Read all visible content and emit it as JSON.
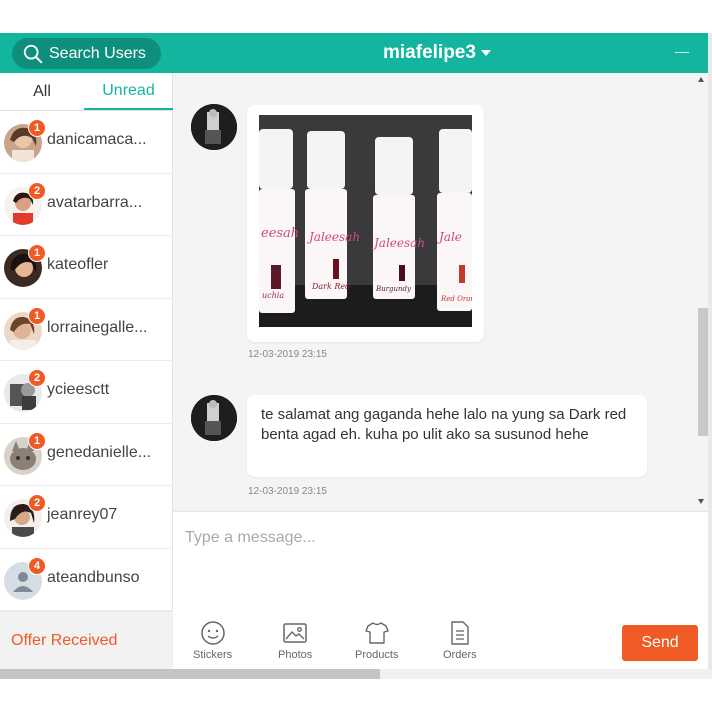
{
  "colors": {
    "brand": "#14b59e",
    "accent": "#f05a24"
  },
  "search": {
    "label": "Search Users",
    "icon": "search-icon"
  },
  "tabs": {
    "all": "All",
    "unread": "Unread",
    "active": "Unread"
  },
  "users": [
    {
      "name": "danicamaca...",
      "unread": "1"
    },
    {
      "name": "avatarbarra...",
      "unread": "2"
    },
    {
      "name": "kateofler",
      "unread": "1"
    },
    {
      "name": "lorrainegalle...",
      "unread": "1"
    },
    {
      "name": "ycieesctt",
      "unread": "2"
    },
    {
      "name": "genedanielle...",
      "unread": "1"
    },
    {
      "name": "jeanrey07",
      "unread": "2"
    },
    {
      "name": "ateandbunso",
      "unread": "4"
    }
  ],
  "offer": {
    "label": "Offer Received"
  },
  "chat": {
    "title": "miafelipe3"
  },
  "messages": [
    {
      "type": "image",
      "timestamp": "12-03-2019 23:15",
      "labels": [
        "Jaleesah",
        "Dark Red",
        "Burgundy",
        "Red Orange"
      ]
    },
    {
      "type": "text",
      "text": "te salamat ang gaganda hehe lalo na yung sa Dark red benta agad eh. kuha po ulit ako sa susunod hehe",
      "timestamp": "12-03-2019 23:15"
    }
  ],
  "composer": {
    "placeholder": "Type a message..."
  },
  "toolbar": {
    "stickers": "Stickers",
    "photos": "Photos",
    "products": "Products",
    "orders": "Orders",
    "send": "Send"
  }
}
